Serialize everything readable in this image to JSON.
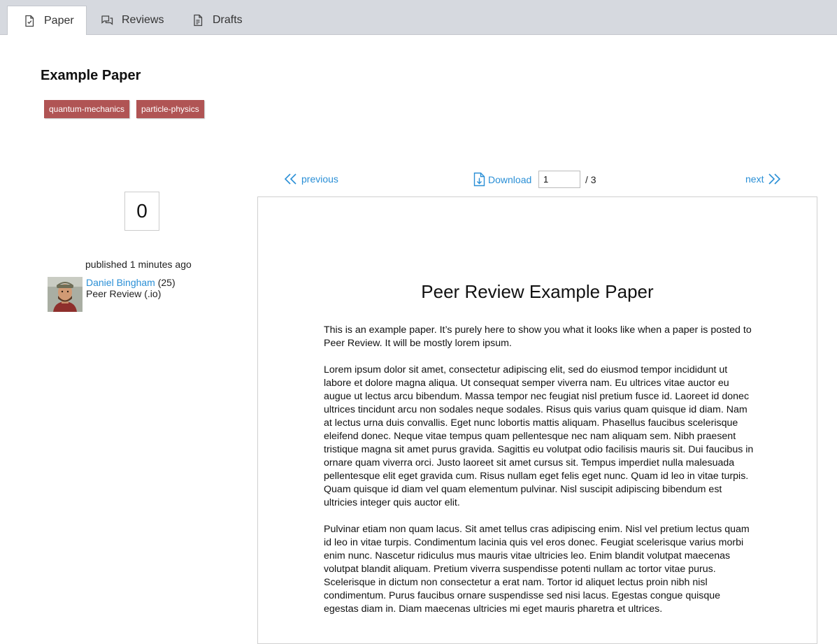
{
  "tabs": [
    {
      "label": "Paper",
      "icon": "file-check-icon",
      "active": true
    },
    {
      "label": "Reviews",
      "icon": "chat-bubbles-icon",
      "active": false
    },
    {
      "label": "Drafts",
      "icon": "file-text-icon",
      "active": false
    }
  ],
  "paper": {
    "title": "Example Paper",
    "tags": [
      "quantum-mechanics",
      "particle-physics"
    ],
    "score": "0",
    "published": "published 1 minutes ago",
    "author": {
      "name": "Daniel Bingham",
      "reputation": "(25)",
      "affiliation": "Peer Review (.io)"
    }
  },
  "pager": {
    "previous": "previous",
    "next": "next",
    "download": "Download",
    "current_page": "1",
    "total": "/ 3"
  },
  "document": {
    "title": "Peer Review Example Paper",
    "paragraphs": [
      "This is an example paper.  It’s purely here to show you what it looks like when a paper is posted to Peer Review.  It will be mostly lorem ipsum.",
      "Lorem ipsum dolor sit amet, consectetur adipiscing elit, sed do eiusmod tempor incididunt ut labore et dolore magna aliqua. Ut consequat semper viverra nam. Eu ultrices vitae auctor eu augue ut lectus arcu bibendum. Massa tempor nec feugiat nisl pretium fusce id. Laoreet id donec ultrices tincidunt arcu non sodales neque sodales. Risus quis varius quam quisque id diam. Nam at lectus urna duis convallis. Eget nunc lobortis mattis aliquam. Phasellus faucibus scelerisque eleifend donec. Neque vitae tempus quam pellentesque nec nam aliquam sem. Nibh praesent tristique magna sit amet purus gravida. Sagittis eu volutpat odio facilisis mauris sit. Dui faucibus in ornare quam viverra orci. Justo laoreet sit amet cursus sit. Tempus imperdiet nulla malesuada pellentesque elit eget gravida cum. Risus nullam eget felis eget nunc. Quam id leo in vitae turpis. Quam quisque id diam vel quam elementum pulvinar. Nisl suscipit adipiscing bibendum est ultricies integer quis auctor elit.",
      "Pulvinar etiam non quam lacus. Sit amet tellus cras adipiscing enim. Nisl vel pretium lectus quam id leo in vitae turpis. Condimentum lacinia quis vel eros donec. Feugiat scelerisque varius morbi enim nunc. Nascetur ridiculus mus mauris vitae ultricies leo. Enim blandit volutpat maecenas volutpat blandit aliquam. Pretium viverra suspendisse potenti nullam ac tortor vitae purus. Scelerisque in dictum non consectetur a erat nam. Tortor id aliquet lectus proin nibh nisl condimentum. Purus faucibus ornare suspendisse sed nisi lacus. Egestas congue quisque egestas diam in. Diam maecenas ultricies mi eget mauris pharetra et ultrices."
    ]
  },
  "colors": {
    "link": "#2a8fd6",
    "tag_bg": "#b05454",
    "tabbar_bg": "#d6d9df"
  }
}
